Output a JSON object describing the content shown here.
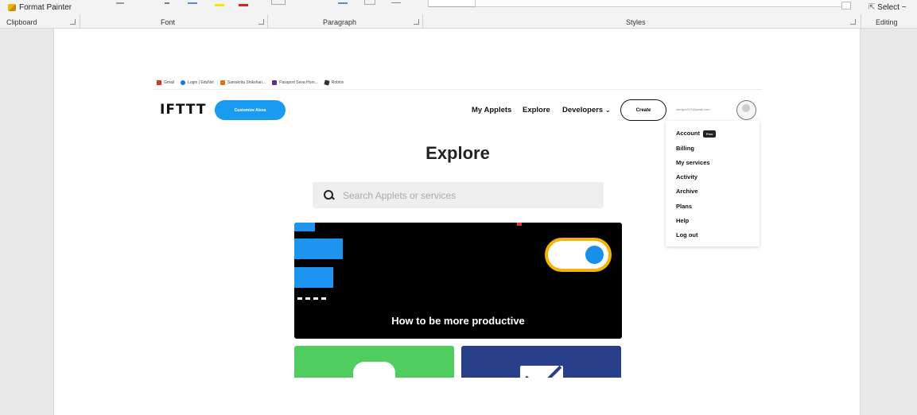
{
  "ribbon": {
    "format_painter_label": "Format Painter",
    "select_label": "Select ~",
    "groups": [
      "Clipboard",
      "Font",
      "Paragraph",
      "Styles",
      "Editing"
    ]
  },
  "browser": {
    "bookmarks": [
      {
        "label": "Gmail",
        "color": "#d93025"
      },
      {
        "label": "Login | EduNxt",
        "color": "#1a73e8"
      },
      {
        "label": "Samskrita Shikshan...",
        "color": "#e37400"
      },
      {
        "label": "Passport Seva Hom...",
        "color": "#5a2d91"
      },
      {
        "label": "Roblox",
        "color": "#333333"
      }
    ],
    "logo": "IFTTT",
    "customize_button": "Customize Alexa",
    "nav": {
      "my_applets": "My Applets",
      "explore": "Explore",
      "developers": "Developers"
    },
    "create_button": "Create",
    "user_email": "studypc017@gmail.com",
    "dropdown": {
      "account": "Account",
      "free_badge": "Free",
      "items": [
        "Billing",
        "My services",
        "Activity",
        "Archive",
        "Plans",
        "Help",
        "Log out"
      ]
    },
    "page_title": "Explore",
    "search_placeholder": "Search Applets or services",
    "featured_card_title": "How to be more productive"
  },
  "colors": {
    "accent_blue": "#1a9bf0",
    "toggle_yellow": "#f4b400",
    "tile_green": "#4fce5f",
    "tile_blue": "#283f8a"
  }
}
